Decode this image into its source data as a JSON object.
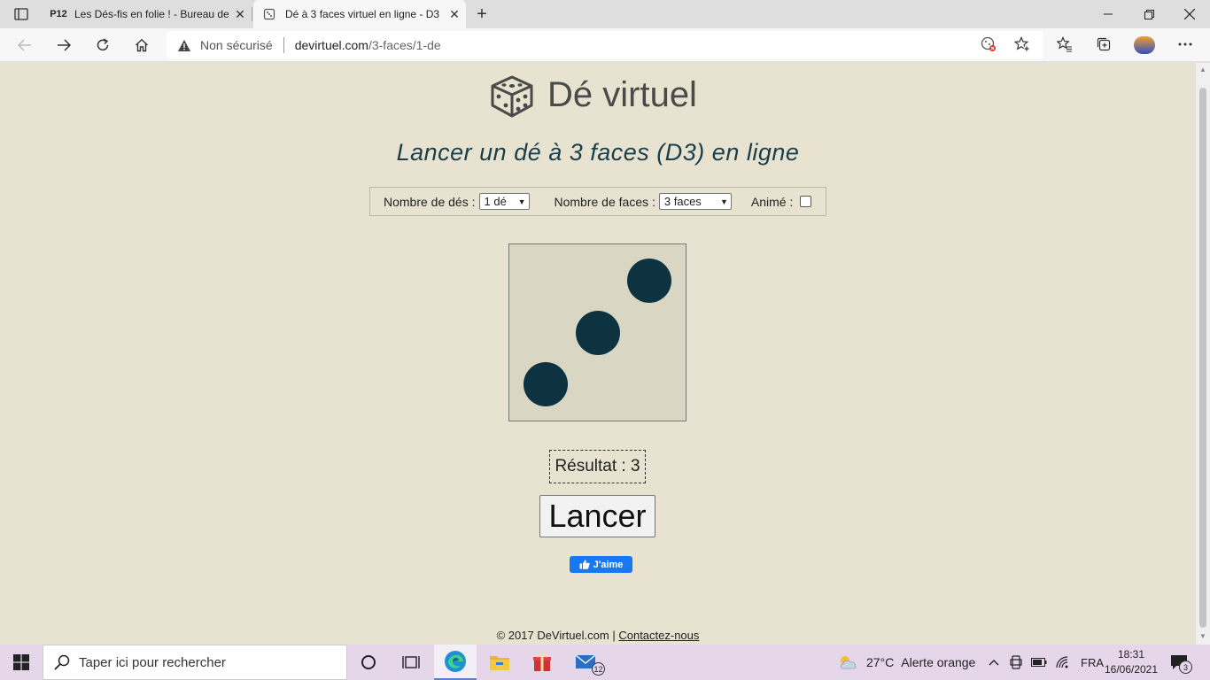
{
  "browser": {
    "tabs": [
      {
        "label": "Les Dés-fis en folie ! - Bureau de",
        "favicon": "P12"
      },
      {
        "label": "Dé à 3 faces virtuel en ligne - D3",
        "favicon": "dice"
      }
    ],
    "address": {
      "security": "Non sécurisé",
      "host": "devirtuel.com",
      "path": "/3-faces/1-de"
    }
  },
  "site": {
    "title": "Dé virtuel",
    "subtitle": "Lancer un dé à 3 faces (D3) en ligne"
  },
  "controls": {
    "dice_label": "Nombre de dés :",
    "dice_value": "1 dé",
    "faces_label": "Nombre de faces :",
    "faces_value": "3 faces",
    "animated_label": "Animé :",
    "animated_checked": false
  },
  "die": {
    "face_value": 3
  },
  "result": {
    "text": "Résultat : 3"
  },
  "launch_label": "Lancer",
  "facebook_like": "J'aime",
  "footer": {
    "copyright": "© 2017 DeVirtuel.com |",
    "contact": "Contactez-nous"
  },
  "taskbar": {
    "search_placeholder": "Taper ici pour rechercher",
    "mail_badge": "12",
    "weather": "27°C",
    "weather_alert": "Alerte orange",
    "language": "FRA",
    "time": "18:31",
    "date": "16/06/2021",
    "notification_count": "3"
  }
}
